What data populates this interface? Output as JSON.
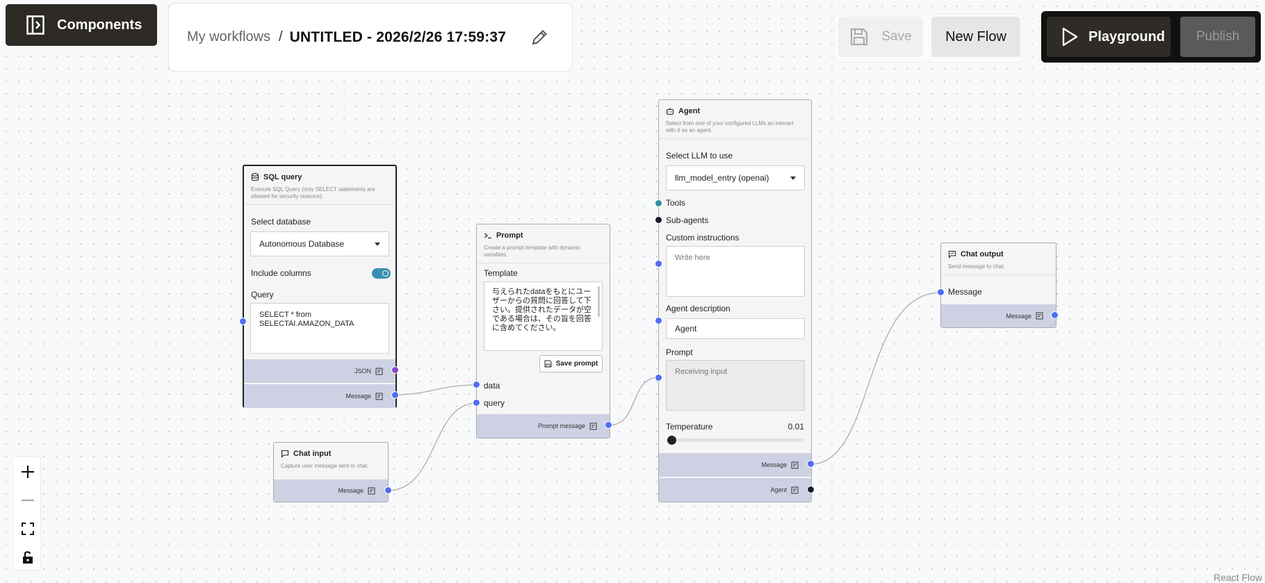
{
  "header": {
    "components_label": "Components",
    "breadcrumb_parent": "My workflows",
    "breadcrumb_separator": "/",
    "flow_title": "UNTITLED - 2026/2/26 17:59:37"
  },
  "toolbar": {
    "save_label": "Save",
    "new_flow_label": "New Flow",
    "playground_label": "Playground",
    "publish_label": "Publish"
  },
  "nodes": {
    "sql": {
      "title": "SQL query",
      "description": "Execute SQL Query (only SELECT statements are allowed for security reasons).",
      "database_label": "Select database",
      "database_value": "Autonomous Database",
      "include_columns_label": "Include columns",
      "include_columns": true,
      "query_label": "Query",
      "query_value": "SELECT * from SELECTAI.AMAZON_DATA",
      "out_json": "JSON",
      "out_message": "Message"
    },
    "chat_input": {
      "title": "Chat input",
      "description": "Capture user message sent in chat.",
      "out_message": "Message"
    },
    "prompt": {
      "title": "Prompt",
      "description": "Create a prompt template with dynamic variables.",
      "template_label": "Template",
      "template_value": "与えられたdataをもとにユーザーからの質問に回答して下さい。提供されたデータが空である場合は、その旨を回答に含めてください。",
      "save_prompt_label": "Save prompt",
      "input_data": "data",
      "input_query": "query",
      "out_prompt_message": "Prompt message"
    },
    "agent": {
      "title": "Agent",
      "description": "Select from one of your configured LLMs an interact with it as an agent.",
      "llm_label": "Select LLM to use",
      "llm_value": "llm_model_entry (openai)",
      "tools_label": "Tools",
      "subagents_label": "Sub-agents",
      "instructions_label": "Custom instructions",
      "instructions_placeholder": "Write here",
      "description_label": "Agent description",
      "description_value": "Agent",
      "prompt_label": "Prompt",
      "prompt_placeholder": "Receiving input",
      "temperature_label": "Temperature",
      "temperature_value": "0.01",
      "temperature_fraction": 0.01,
      "out_message": "Message",
      "out_agent": "Agent"
    },
    "chat_output": {
      "title": "Chat output",
      "description": "Send message to chat.",
      "input_message": "Message",
      "out_message": "Message"
    }
  },
  "attribution": "React Flow",
  "colors": {
    "handle_blue": "#4f6ef2",
    "handle_purple": "#8b44c9",
    "handle_teal": "#2b8f9a",
    "output_band": "#cdd1e3",
    "toggle_on": "#3a8fb0"
  }
}
